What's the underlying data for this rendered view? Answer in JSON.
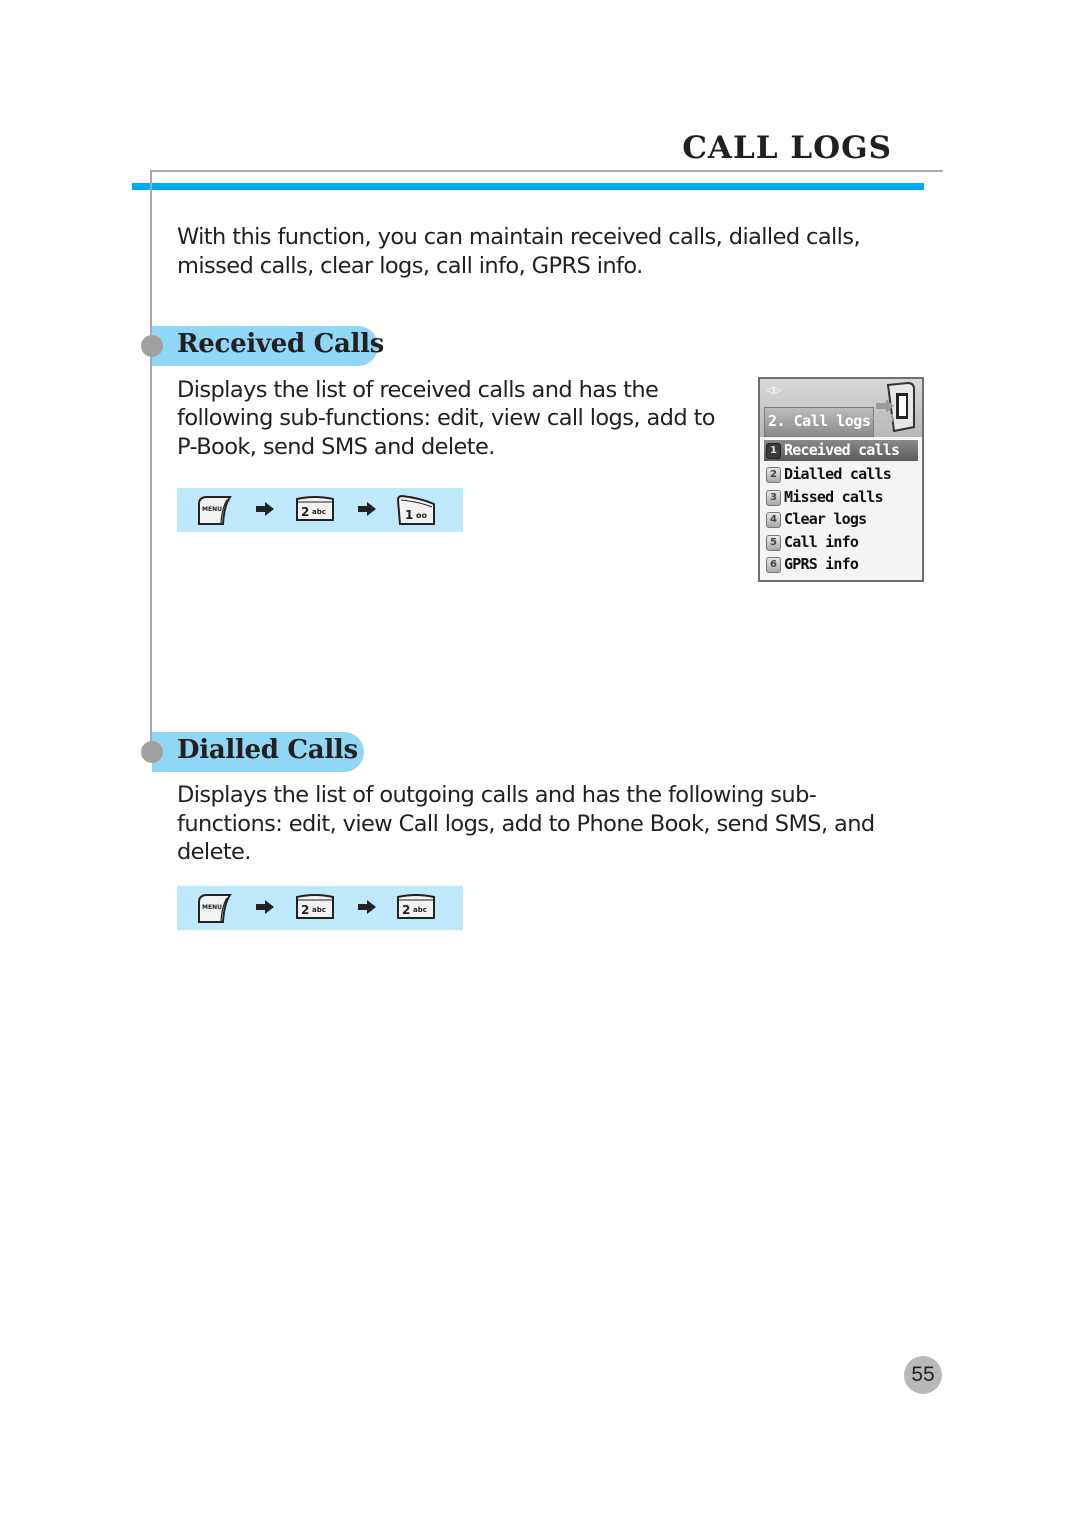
{
  "header": {
    "title": "CALL LOGS"
  },
  "intro": {
    "lines": [
      "With this function, you can maintain received calls, dialled calls,",
      "missed calls, clear logs, call info, GPRS info."
    ]
  },
  "sections": [
    {
      "title": "Received Calls",
      "lines": [
        "Displays the list of received calls and has the",
        "following sub-functions: edit, view call logs, add to",
        "P-Book, send SMS and delete."
      ],
      "key_sequence": [
        {
          "key": "menu-key",
          "label": "MENU"
        },
        {
          "key": "2-key",
          "label": "2",
          "sub": "abc"
        },
        {
          "key": "1-key",
          "label": "1",
          "sub": "oo"
        }
      ]
    },
    {
      "title": "Dialled Calls",
      "lines": [
        "Displays the list of outgoing calls and has the following sub-",
        "functions: edit, view Call logs, add to Phone Book, send SMS, and",
        "delete."
      ],
      "key_sequence": [
        {
          "key": "menu-key",
          "label": "MENU"
        },
        {
          "key": "2-key",
          "label": "2",
          "sub": "abc"
        },
        {
          "key": "2-key",
          "label": "2",
          "sub": "abc"
        }
      ]
    }
  ],
  "phone_screen": {
    "nav_glyph": "◁▷",
    "title": "2. Call logs",
    "items": [
      {
        "num": "1",
        "label": "Received calls",
        "selected": true
      },
      {
        "num": "2",
        "label": "Dialled calls",
        "selected": false
      },
      {
        "num": "3",
        "label": "Missed calls",
        "selected": false
      },
      {
        "num": "4",
        "label": "Clear logs",
        "selected": false
      },
      {
        "num": "5",
        "label": "Call info",
        "selected": false
      },
      {
        "num": "6",
        "label": "GPRS info",
        "selected": false
      }
    ]
  },
  "footer": {
    "page_number": "55"
  },
  "colors": {
    "accent_blue": "#00adef",
    "pill_blue": "#8fd7f5",
    "strip_blue": "#bfe8fb",
    "rule_grey": "#a8a8a8"
  }
}
